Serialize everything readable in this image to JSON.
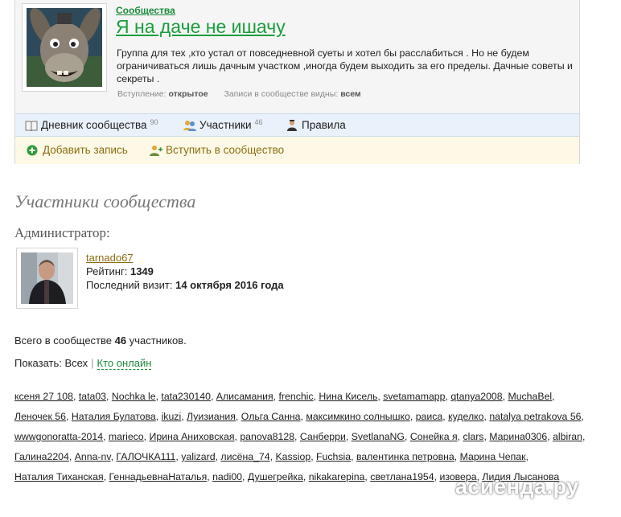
{
  "community": {
    "tag": "Сообщества",
    "title": "Я на даче не ишачу",
    "description": "Группа для тех ,кто устал от повседневной суеты и хотел бы расслабиться . Но не будем ограничиваться лишь дачным участком ,иногда будем выходить за его пределы. Дачные советы и секреты .",
    "entry_label": "Вступление:",
    "entry_value": "открытое",
    "visible_label": "Записи в сообществе видны:",
    "visible_value": "всем"
  },
  "nav": {
    "diary_label": "Дневник сообщества",
    "diary_count": "90",
    "members_label": "Участники",
    "members_count": "46",
    "rules_label": "Правила"
  },
  "actions": {
    "add_label": "Добавить запись",
    "join_label": "Вступить в сообщество"
  },
  "members_section": {
    "heading": "Участники сообщества",
    "admin_label": "Администратор:"
  },
  "admin": {
    "nick": "tarnado67",
    "rating_label": "Рейтинг:",
    "rating_value": "1349",
    "visit_label": "Последний визит:",
    "visit_value": "14 октября 2016 года"
  },
  "totals": {
    "prefix": "Всего в сообществе",
    "count": "46",
    "suffix": "участников."
  },
  "filter": {
    "label": "Показать:",
    "all": "Всех",
    "online": "Кто онлайн"
  },
  "member_list": [
    "ксеня 27 108",
    "tata03",
    "Nochka le",
    "tata230140",
    "Алисамания",
    "frenchic",
    "Нина Кисель",
    "svetamamapp",
    "qtanya2008",
    "MuchaBel",
    "Леночек 56",
    "Наталия Булатова",
    "ikuzi",
    "Луизиания",
    "Ольга Санна",
    "максимкино солнышко",
    "раиса",
    "куделко",
    "natalya petrakova 56",
    "wwwgonoratta-2014",
    "marieco",
    "Ирина Аниховская",
    "panova8128",
    "Санберри",
    "SvetlanaNG",
    "Сонейка я",
    "clars",
    "Марина0306",
    "albiran",
    "Галина2204",
    "Anna-nv",
    "ГАЛОЧКА111",
    "yalizard",
    "лисёна_74",
    "Kassiop",
    "Fuchsia",
    "валентинка петровна",
    "Марина Чепак",
    "Наталия Тиханская",
    "ГеннадьевнаНаталья",
    "nadi00",
    "Душегрейка",
    "nikakarepina",
    "светлана1954",
    "изовера",
    "Лидия Лысанова"
  ],
  "watermark": "асиенда.ру",
  "colors": {
    "accent_green": "#1a9f3e",
    "nav_bg": "#e9f1fa",
    "actions_bg": "#fdf9e6",
    "link_brown": "#8a6d10"
  }
}
